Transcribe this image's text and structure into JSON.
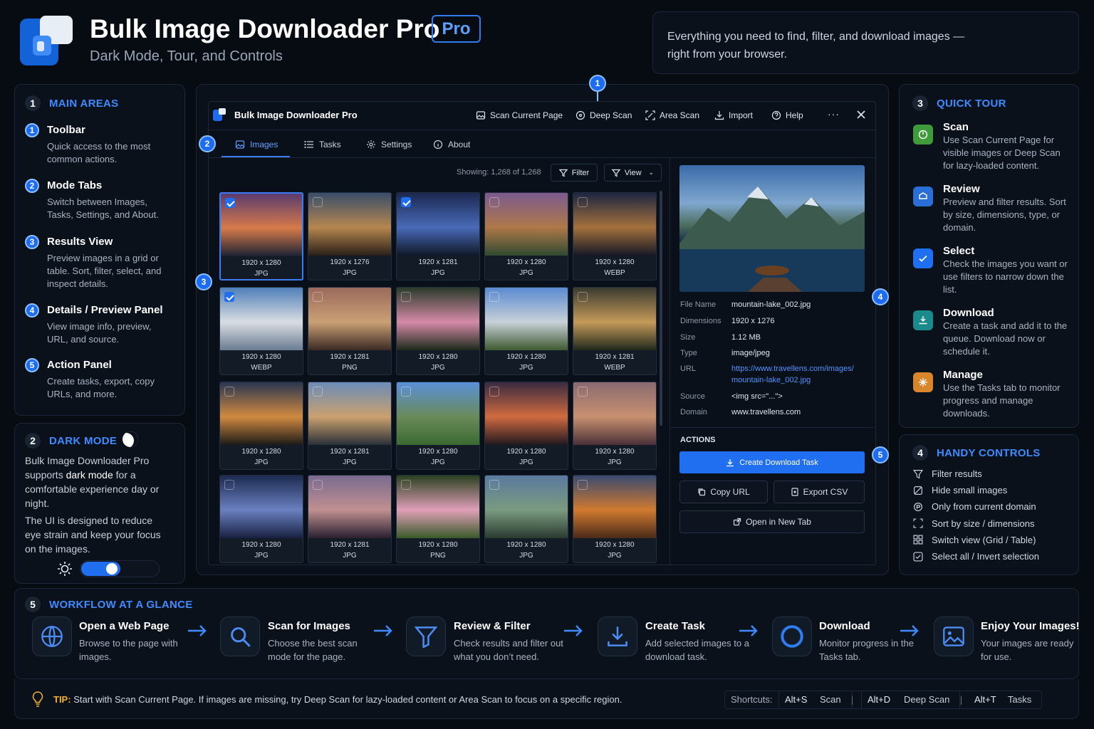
{
  "header": {
    "title": "Bulk Image Downloader Pro",
    "badge": "Pro",
    "subtitle": "Dark Mode, Tour, and Controls",
    "tagline": "Everything you need to find, filter, and download images —right from your browser."
  },
  "main_areas": {
    "num": "1",
    "title": "MAIN AREAS",
    "items": [
      {
        "num": "1",
        "title": "Toolbar",
        "desc": "Quick access to the most common actions."
      },
      {
        "num": "2",
        "title": "Mode Tabs",
        "desc": "Switch between Images, Tasks, Settings, and About."
      },
      {
        "num": "3",
        "title": "Results View",
        "desc": "Preview images in a grid or table. Sort, filter, select, and inspect details."
      },
      {
        "num": "4",
        "title": "Details / Preview Panel",
        "desc": "View image info, preview, URL, and source."
      },
      {
        "num": "5",
        "title": "Action Panel",
        "desc": "Create tasks, export, copy URLs, and more."
      }
    ]
  },
  "dark_mode": {
    "num": "2",
    "title": "DARK MODE",
    "p1_a": "Bulk Image Downloader Pro supports ",
    "p1_b": "dark mode",
    "p1_c": " for a comfortable experience day or night.",
    "p2": "The UI is designed to reduce eye strain and keep your focus on the images.",
    "toggle_on": true
  },
  "app": {
    "title": "Bulk Image Downloader Pro",
    "toolbar": [
      {
        "label": "Scan Current Page",
        "icon": "image-icon"
      },
      {
        "label": "Deep Scan",
        "icon": "deep-scan-icon"
      },
      {
        "label": "Area Scan",
        "icon": "area-scan-icon"
      },
      {
        "label": "Import",
        "icon": "import-icon"
      },
      {
        "label": "Help",
        "icon": "help-icon"
      }
    ],
    "tabs": [
      {
        "label": "Images",
        "active": true
      },
      {
        "label": "Tasks"
      },
      {
        "label": "Settings"
      },
      {
        "label": "About"
      }
    ],
    "showing": "Showing: 1,268 of 1,268",
    "filter_label": "Filter",
    "view_label": "View",
    "thumbs": [
      {
        "dim": "1920 x 1280",
        "fmt": "JPG",
        "checked": true,
        "colors": [
          "#5b3b6e",
          "#d77a4a",
          "#1c2233"
        ]
      },
      {
        "dim": "1920 x 1276",
        "fmt": "JPG",
        "checked": false,
        "colors": [
          "#3a4d6a",
          "#b5864f",
          "#2a2018"
        ]
      },
      {
        "dim": "1920 x 1281",
        "fmt": "JPG",
        "checked": true,
        "colors": [
          "#1a2850",
          "#4a6ab8",
          "#101828"
        ]
      },
      {
        "dim": "1920 x 1280",
        "fmt": "JPG",
        "checked": false,
        "colors": [
          "#7b5a8e",
          "#b0784a",
          "#2f4a30"
        ]
      },
      {
        "dim": "1920 x 1280",
        "fmt": "WEBP",
        "checked": false,
        "colors": [
          "#1d2540",
          "#a4703d",
          "#151825"
        ]
      },
      {
        "dim": "1920 x 1280",
        "fmt": "WEBP",
        "checked": true,
        "colors": [
          "#4f7fb8",
          "#d9dde2",
          "#6a7c92"
        ]
      },
      {
        "dim": "1920 x 1281",
        "fmt": "PNG",
        "checked": false,
        "colors": [
          "#9a6a5c",
          "#caa075",
          "#3a2a24"
        ]
      },
      {
        "dim": "1920 x 1280",
        "fmt": "JPG",
        "checked": false,
        "colors": [
          "#2a3a2a",
          "#d58aa8",
          "#1d2a1a"
        ]
      },
      {
        "dim": "1920 x 1280",
        "fmt": "JPG",
        "checked": false,
        "colors": [
          "#5a8ad0",
          "#c8d0d8",
          "#3e5a30"
        ]
      },
      {
        "dim": "1920 x 1281",
        "fmt": "WEBP",
        "checked": false,
        "colors": [
          "#3a3a30",
          "#c59a5a",
          "#20281c"
        ]
      },
      {
        "dim": "1920 x 1280",
        "fmt": "JPG",
        "checked": false,
        "colors": [
          "#2a3550",
          "#d08a40",
          "#1c1a18"
        ]
      },
      {
        "dim": "1920 x 1281",
        "fmt": "JPG",
        "checked": false,
        "colors": [
          "#6b8cb8",
          "#caa070",
          "#2a3038"
        ]
      },
      {
        "dim": "1920 x 1280",
        "fmt": "JPG",
        "checked": false,
        "colors": [
          "#5a90d8",
          "#6a8a5a",
          "#3a6a30"
        ]
      },
      {
        "dim": "1920 x 1280",
        "fmt": "JPG",
        "checked": false,
        "colors": [
          "#3a2a40",
          "#d06a40",
          "#201820"
        ]
      },
      {
        "dim": "1920 x 1280",
        "fmt": "JPG",
        "checked": false,
        "colors": [
          "#8a6a70",
          "#c89070",
          "#4a3038"
        ]
      },
      {
        "dim": "1920 x 1280",
        "fmt": "JPG",
        "checked": false,
        "colors": [
          "#1d2a50",
          "#6a80c0",
          "#182040"
        ]
      },
      {
        "dim": "1920 x 1281",
        "fmt": "JPG",
        "checked": false,
        "colors": [
          "#7a6a90",
          "#c09090",
          "#2a2030"
        ]
      },
      {
        "dim": "1920 x 1280",
        "fmt": "PNG",
        "checked": false,
        "colors": [
          "#2a4020",
          "#e0a0b8",
          "#3a5a28"
        ]
      },
      {
        "dim": "1920 x 1280",
        "fmt": "JPG",
        "checked": false,
        "colors": [
          "#5a7aa0",
          "#7a9a80",
          "#2a3a30"
        ]
      },
      {
        "dim": "1920 x 1280",
        "fmt": "JPG",
        "checked": false,
        "colors": [
          "#3a4a70",
          "#d07a30",
          "#4a2a18"
        ]
      }
    ],
    "details": {
      "rows": [
        {
          "k": "File Name",
          "v": "mountain-lake_002.jpg"
        },
        {
          "k": "Dimensions",
          "v": "1920 x 1276"
        },
        {
          "k": "Size",
          "v": "1.12 MB"
        },
        {
          "k": "Type",
          "v": "image/jpeg"
        },
        {
          "k": "URL",
          "v": "https://www.travellens.com/images/",
          "v2": "mountain-lake_002.jpg"
        },
        {
          "k": "Source",
          "v": "<img src=\"...\">"
        },
        {
          "k": "Domain",
          "v": "www.travellens.com"
        }
      ]
    },
    "actions": {
      "title": "ACTIONS",
      "create": "Create Download Task",
      "copy": "Copy URL",
      "export": "Export CSV",
      "open": "Open in New Tab"
    },
    "callouts": [
      "1",
      "2",
      "3",
      "4",
      "5"
    ]
  },
  "quick_tour": {
    "num": "3",
    "title": "QUICK TOUR",
    "items": [
      {
        "title": "Scan",
        "desc": "Use Scan Current Page for visible images or Deep Scan for lazy-loaded content.",
        "color": "#3f9a3a"
      },
      {
        "title": "Review",
        "desc": "Preview and filter results. Sort by size, dimensions, type, or domain.",
        "color": "#2a6fd6"
      },
      {
        "title": "Select",
        "desc": "Check the images you want or use filters to narrow down the list.",
        "color": "#1f6ff0"
      },
      {
        "title": "Download",
        "desc": "Create a task and add it to the queue. Download now or schedule it.",
        "color": "#1a8a8a"
      },
      {
        "title": "Manage",
        "desc": "Use the Tasks tab to monitor progress and manage downloads.",
        "color": "#d9862a"
      }
    ]
  },
  "handy": {
    "num": "4",
    "title": "HANDY CONTROLS",
    "items": [
      "Filter results",
      "Hide small images",
      "Only from current domain",
      "Sort by size / dimensions",
      "Switch view (Grid / Table)",
      "Select all / Invert selection"
    ]
  },
  "workflow": {
    "num": "5",
    "title": "WORKFLOW AT A GLANCE",
    "steps": [
      {
        "title": "Open a Web Page",
        "desc": "Browse to the page with images."
      },
      {
        "title": "Scan for Images",
        "desc": "Choose the best scan mode for the page."
      },
      {
        "title": "Review & Filter",
        "desc": "Check results and filter out what you don’t need."
      },
      {
        "title": "Create Task",
        "desc": "Add selected images to a download task."
      },
      {
        "title": "Download",
        "desc": "Monitor progress in the Tasks tab."
      },
      {
        "title": "Enjoy Your Images!",
        "desc": "Your images are ready for use."
      }
    ]
  },
  "tip": {
    "label": "TIP:",
    "text": "Start with Scan Current Page. If images are missing, try Deep Scan for lazy-loaded content or Area Scan to focus on a specific region.",
    "shortcuts_label": "Shortcuts:",
    "shortcuts": [
      {
        "key": "Alt+S",
        "name": "Scan"
      },
      {
        "key": "Alt+D",
        "name": "Deep Scan"
      },
      {
        "key": "Alt+T",
        "name": "Tasks"
      }
    ]
  }
}
